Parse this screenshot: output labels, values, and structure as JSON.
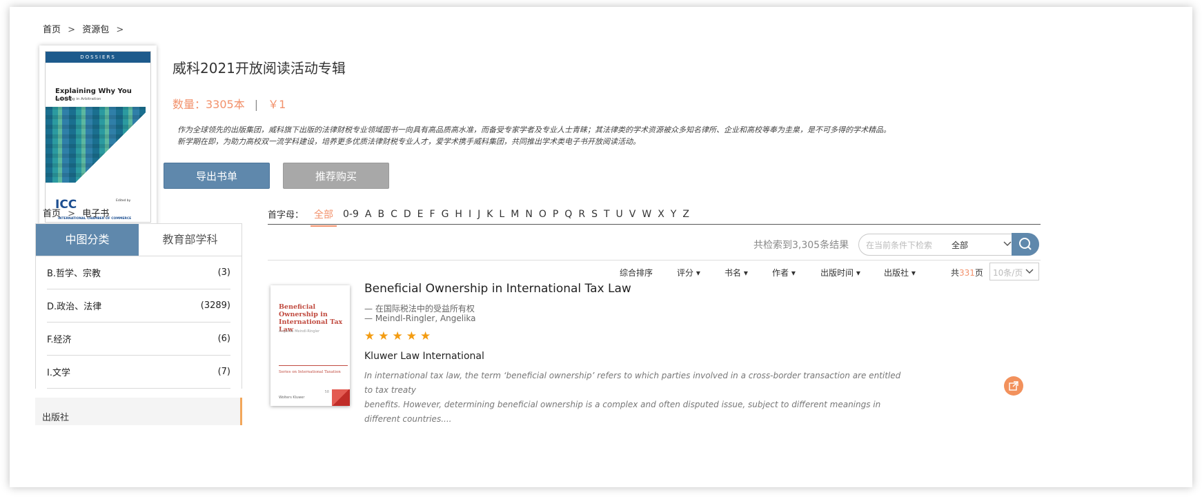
{
  "breadcrumb_top": [
    "首页",
    ">",
    "资源包",
    ">"
  ],
  "collection": {
    "title": "威科2021开放阅读活动专辑",
    "count": "数量：3305本",
    "separator": "|",
    "price": "￥1",
    "description_line1": "作为全球领先的出版集团，威科旗下出版的法律财税专业领域图书一向具有高品质高水准，而备受专家学者及专业人士青睐；其法律类的学术资源被众多知名律所、企业和高校等奉为圭臬，是不可多得的学术精品。",
    "description_line2": "新学期在即，为助力高校双一流学科建设，培养更多优质法律财税专业人才，爱学术携手威科集团，共同推出学术类电子书开放阅读活动。",
    "cover": {
      "band": "DOSSIERS",
      "title": "Explaining Why You Lost",
      "subtitle": "Reasoning in Arbitration",
      "logo": "ICC",
      "logo_text": "INTERNATIONAL CHAMBER OF COMMERCE",
      "editor": "Edited by"
    },
    "buttons": {
      "export": "导出书单",
      "recommend": "推荐购买"
    }
  },
  "breadcrumb_second": [
    "首页",
    ">",
    "电子书"
  ],
  "sidebar": {
    "tabs": [
      "中图分类",
      "教育部学科"
    ],
    "categories": [
      {
        "name": "B.哲学、宗教",
        "count": "(3)"
      },
      {
        "name": "D.政治、法律",
        "count": "(3289)"
      },
      {
        "name": "F.经济",
        "count": "(6)"
      },
      {
        "name": "I.文学",
        "count": "(7)"
      }
    ],
    "publisher_panel": "出版社"
  },
  "letter_filter": {
    "label": "首字母：",
    "items": [
      "全部",
      "0-9",
      "A",
      "B",
      "C",
      "D",
      "E",
      "F",
      "G",
      "H",
      "I",
      "J",
      "K",
      "L",
      "M",
      "N",
      "O",
      "P",
      "Q",
      "R",
      "S",
      "T",
      "U",
      "V",
      "W",
      "X",
      "Y",
      "Z"
    ],
    "active": "全部"
  },
  "search": {
    "result_count": "共检索到3,305条结果",
    "placeholder": "在当前条件下检索",
    "scope": "全部"
  },
  "sort_bar": {
    "items": [
      "综合排序",
      "评分 ▾",
      "书名 ▾",
      "作者 ▾",
      "出版时间 ▾",
      "出版社 ▾"
    ],
    "pages_prefix": "共",
    "pages_count": "331",
    "pages_suffix": "页",
    "per_page": "10条/页"
  },
  "book": {
    "title": "Beneficial Ownership in International Tax Law",
    "subtitle_cn": "— 在国际税法中的受益所有权",
    "author": "— Meindl-Ringler, Angelika",
    "rating": 5,
    "stars": "★★★★★",
    "publisher": "Kluwer Law International",
    "abstract_line1": "In international tax law, the term ‘beneficial ownership’ refers to which parties involved in a cross-border transaction are entitled to tax treaty",
    "abstract_line2": "benefits. However, determining beneficial ownership is a complex and often disputed issue, subject to different meanings in different countries....",
    "cover": {
      "title": "Beneficial Ownership in International Tax Law",
      "author": "Angelika Meindl-Ringler",
      "series": "Series on International Taxation",
      "publisher_logo": "Wolters Kluwer",
      "volume": "58"
    }
  }
}
